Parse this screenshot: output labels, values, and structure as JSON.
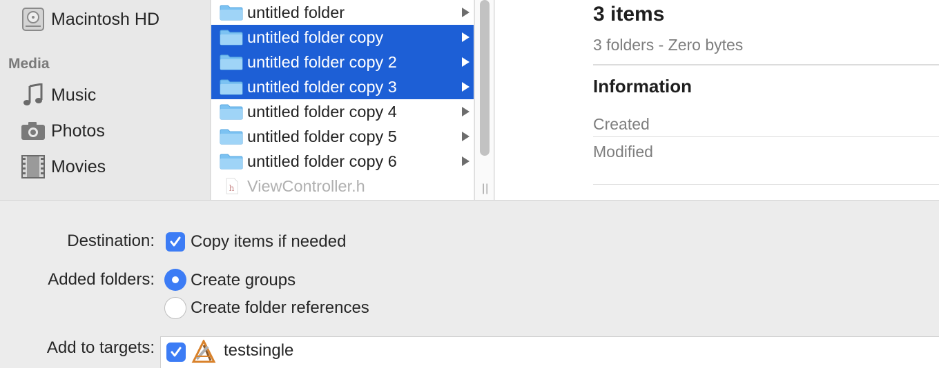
{
  "sidebar": {
    "top_item": {
      "label": "Macintosh HD",
      "icon": "hard-drive-icon"
    },
    "media_heading": "Media",
    "items": [
      {
        "label": "Music",
        "icon": "music-note-icon"
      },
      {
        "label": "Photos",
        "icon": "camera-icon"
      },
      {
        "label": "Movies",
        "icon": "film-icon"
      }
    ]
  },
  "files": [
    {
      "name": "untitled folder",
      "selected": false
    },
    {
      "name": "untitled folder copy",
      "selected": true
    },
    {
      "name": "untitled folder copy 2",
      "selected": true
    },
    {
      "name": "untitled folder copy 3",
      "selected": true
    },
    {
      "name": "untitled folder copy 4",
      "selected": false
    },
    {
      "name": "untitled folder copy 5",
      "selected": false
    },
    {
      "name": "untitled folder copy 6",
      "selected": false
    },
    {
      "name": "ViewController.h",
      "selected": false
    }
  ],
  "preview": {
    "title": "3 items",
    "subtitle": "3 folders - Zero bytes",
    "info_heading": "Information",
    "created_label": "Created",
    "modified_label": "Modified"
  },
  "options": {
    "destination_label": "Destination:",
    "copy_items_label": "Copy items if needed",
    "copy_items_checked": true,
    "added_folders_label": "Added folders:",
    "create_groups_label": "Create groups",
    "create_folder_refs_label": "Create folder references",
    "selected_folder_option": "Create groups",
    "add_targets_label": "Add to targets:",
    "target_name": "testsingle",
    "target_checked": true
  },
  "colors": {
    "selection": "#1d5fd6",
    "accent": "#3c7cf5",
    "folder": "#7cc2f2"
  }
}
